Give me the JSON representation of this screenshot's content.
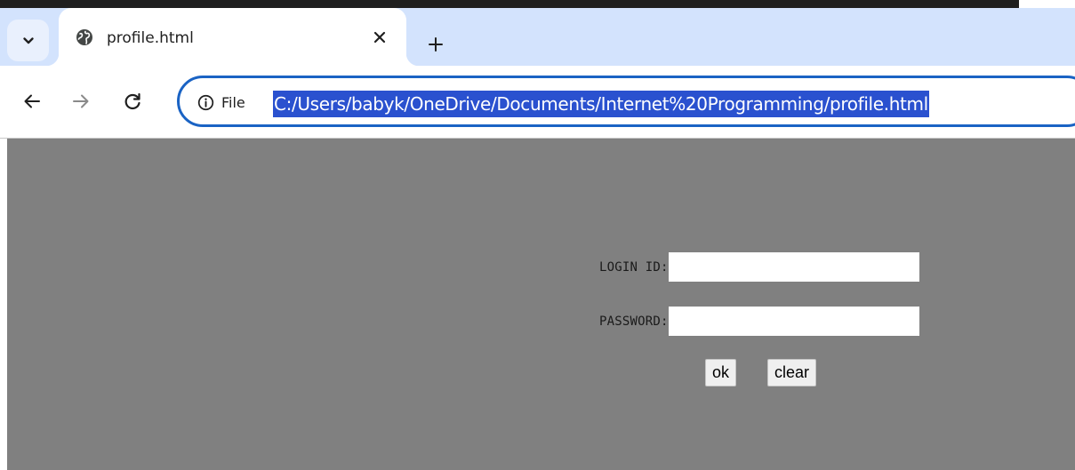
{
  "browser": {
    "tab": {
      "title": "profile.html"
    },
    "omnibox": {
      "security_label": "File",
      "url": "C:/Users/babyk/OneDrive/Documents/Internet%20Programming/profile.html"
    }
  },
  "icons": {
    "tab_search": "chevron-down-icon",
    "favicon": "globe-icon",
    "tab_close": "close-icon",
    "new_tab": "plus-icon",
    "back": "arrow-left-icon",
    "forward": "arrow-right-icon",
    "reload": "reload-icon",
    "site_info": "info-icon"
  },
  "colors": {
    "tab_bar": "#d3e3fd",
    "omnibox_border": "#1a63c4",
    "url_highlight": "#2a51cf",
    "page_background": "#808080"
  },
  "page": {
    "login_label": "LOGIN ID:",
    "login_value": "",
    "password_label": "PASSWORD:",
    "password_value": "",
    "ok_label": "ok",
    "clear_label": "clear"
  }
}
